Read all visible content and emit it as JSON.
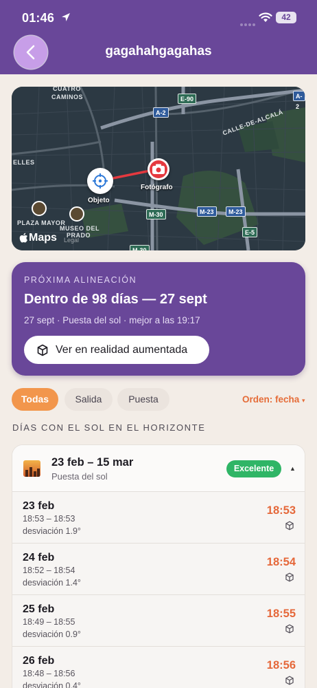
{
  "status_bar": {
    "time": "01:46",
    "battery": "42"
  },
  "header": {
    "title": "gagahahgagahas"
  },
  "map": {
    "labels": {
      "cuatro": "CUATRO",
      "caminos": "CAMINOS",
      "calle_alcala": "CALLE-DE-ALCALÁ",
      "elles": "ELLES",
      "plaza_mayor": "PLAZA MAYOR",
      "museo1": "MUSEO DEL",
      "museo2": "PRADO"
    },
    "road_signs": {
      "e90": "E-90",
      "a2_left": "A-2",
      "a2_right": "A-2",
      "m30": "M-30",
      "m23a": "M-23",
      "m23b": "M-23",
      "e5": "E-5",
      "m30b": "M-30"
    },
    "object_label": "Objeto",
    "photographer_label": "Fotógrafo",
    "attribution": "Maps",
    "legal": "Legal"
  },
  "next_alignment": {
    "kicker": "PRÓXIMA ALINEACIÓN",
    "title": "Dentro de 98 días — 27 sept",
    "subtitle": "27 sept · Puesta del sol · mejor a las 19:17",
    "ar_button": "Ver en realidad aumentada"
  },
  "filters": {
    "all": "Todas",
    "sunrise": "Salida",
    "sunset": "Puesta",
    "order": "Orden: fecha",
    "order_caret": "▾"
  },
  "section_title": "DÍAS CON EL SOL EN EL HORIZONTE",
  "group": {
    "range": "23 feb – 15 mar",
    "kind": "Puesta del sol",
    "badge": "Excelente",
    "caret": "▲"
  },
  "rows": [
    {
      "date": "23 feb",
      "window": "18:53 – 18:53",
      "deviation": "desviación 1.9°",
      "time": "18:53"
    },
    {
      "date": "24 feb",
      "window": "18:52 – 18:54",
      "deviation": "desviación 1.4°",
      "time": "18:54"
    },
    {
      "date": "25 feb",
      "window": "18:49 – 18:55",
      "deviation": "desviación 0.9°",
      "time": "18:55"
    },
    {
      "date": "26 feb",
      "window": "18:48 – 18:56",
      "deviation": "desviación 0.4°",
      "time": "18:56"
    }
  ],
  "colors": {
    "header_purple": "#694799",
    "accent_orange": "#f2964c",
    "time_orange": "#e5683a",
    "badge_green": "#2fb566",
    "camera_red": "#e5393f"
  },
  "icons": [
    "location-arrow-icon",
    "wifi-icon",
    "back-chevron-icon",
    "crosshair-icon",
    "camera-icon",
    "ar-cube-icon",
    "apple-logo-icon"
  ]
}
